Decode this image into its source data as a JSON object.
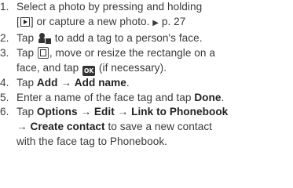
{
  "steps": [
    {
      "number": "1.",
      "line1": "Select a photo by pressing and holding",
      "line2_pre": "[",
      "line2_post": "] or capture a new photo.",
      "arrow": "▶",
      "page_ref": "p. 27"
    },
    {
      "number": "2.",
      "pre": "Tap",
      "post": "to add a tag to a person's face."
    },
    {
      "number": "3.",
      "pre": "Tap",
      "line1_post": ", move or resize the rectangle on a",
      "line2_pre": "face, and tap",
      "line2_post": "(if necessary).",
      "ok_label": "OK"
    },
    {
      "number": "4.",
      "pre": "Tap",
      "add": "Add",
      "arrow": "→",
      "add_name": "Add name",
      "end": "."
    },
    {
      "number": "5.",
      "pre": "Enter a name of the face tag and tap",
      "done": "Done",
      "end": "."
    },
    {
      "number": "6.",
      "pre": "Tap",
      "options": "Options",
      "arrow1": "→",
      "edit": "Edit",
      "arrow2": "→",
      "link": "Link to Phonebook",
      "arrow3": "→",
      "create": "Create contact",
      "line2_post": "to save a new contact",
      "line3": "with the face tag to Phonebook."
    }
  ],
  "icons": {
    "play": "play-button-icon",
    "face_tag": "face-tag-icon",
    "rectangle": "face-rectangle-icon",
    "ok": "ok-button-icon"
  }
}
